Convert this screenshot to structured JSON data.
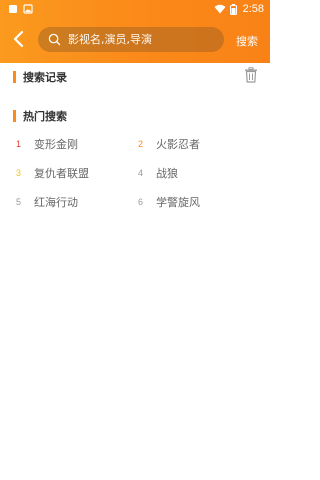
{
  "status_bar": {
    "time": "2:58",
    "icons": [
      "notification-icon",
      "image-icon",
      "wifi-icon",
      "battery-icon"
    ]
  },
  "header": {
    "search_placeholder": "影视名,演员,导演",
    "search_value": "",
    "search_button": "搜索"
  },
  "history": {
    "title": "搜索记录"
  },
  "hot": {
    "title": "热门搜索",
    "items": [
      {
        "rank": "1",
        "label": "变形金刚",
        "rank_color": "#e53935"
      },
      {
        "rank": "2",
        "label": "火影忍者",
        "rank_color": "#fb8c1b"
      },
      {
        "rank": "3",
        "label": "复仇者联盟",
        "rank_color": "#f4c21f"
      },
      {
        "rank": "4",
        "label": "战狼",
        "rank_color": "#999999"
      },
      {
        "rank": "5",
        "label": "红海行动",
        "rank_color": "#999999"
      },
      {
        "rank": "6",
        "label": "学警旋风",
        "rank_color": "#999999"
      }
    ]
  },
  "colors": {
    "accent": "#fb8c1b"
  }
}
